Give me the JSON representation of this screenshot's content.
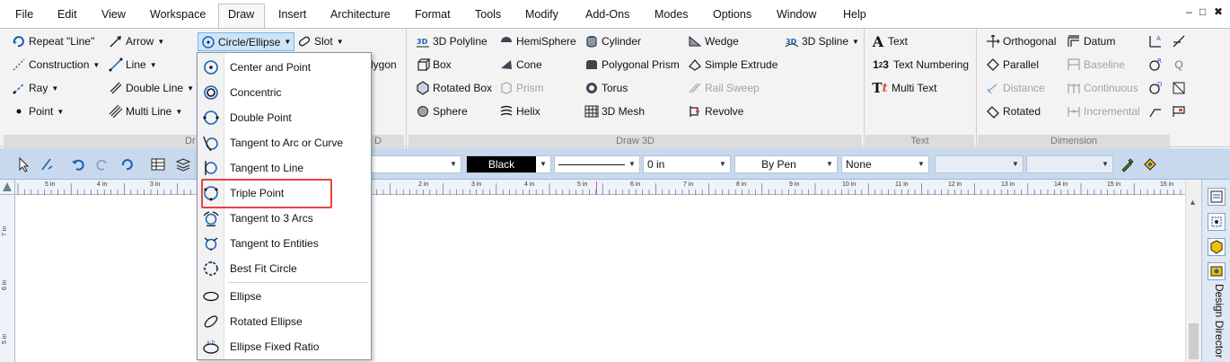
{
  "menubar": {
    "items": [
      "File",
      "Edit",
      "View",
      "Workspace",
      "Draw",
      "Insert",
      "Architecture",
      "Format",
      "Tools",
      "Modify",
      "Add-Ons",
      "Modes",
      "Options",
      "Window",
      "Help"
    ],
    "active": "Draw",
    "window_controls": [
      "–",
      "□",
      "✖"
    ]
  },
  "ribbon": {
    "draw2d": {
      "col1": [
        "Repeat \"Line\"",
        "Construction",
        "Ray",
        "Point"
      ],
      "col2": [
        "Arrow",
        "Line",
        "Double Line",
        "Multi Line"
      ],
      "circle_ellipse": "Circle/Ellipse",
      "slot": "Slot",
      "polygon_partial": "lygon",
      "group_partial_left": "Dr",
      "group_partial_right": "D"
    },
    "draw3d": {
      "col1": [
        "3D Polyline",
        "Box",
        "Rotated Box",
        "Sphere"
      ],
      "col2": [
        "HemiSphere",
        "Cone",
        "Prism",
        "Helix"
      ],
      "col3": [
        "Cylinder",
        "Polygonal Prism",
        "Torus",
        "3D Mesh"
      ],
      "col4": [
        "Wedge",
        "Simple Extrude",
        "Rail Sweep",
        "Revolve"
      ],
      "spline": "3D Spline",
      "label": "Draw 3D"
    },
    "text": {
      "items": [
        "Text",
        "Text Numbering",
        "Multi Text"
      ],
      "label": "Text"
    },
    "dimension": {
      "col1": [
        "Orthogonal",
        "Parallel",
        "Distance",
        "Rotated"
      ],
      "col2": [
        "Datum",
        "Baseline",
        "Continuous",
        "Incremental"
      ],
      "label": "Dimension"
    }
  },
  "toolbar": {
    "color": "Black",
    "thickness": "0 in",
    "pen": "By Pen",
    "fill": "None"
  },
  "ruler": {
    "labels": [
      "5 in",
      "4 in",
      "3 in",
      "2 in",
      "3 in",
      "4 in",
      "5 in",
      "6 in",
      "7 in",
      "8 in",
      "9 in",
      "10 in",
      "11 in",
      "12 in",
      "13 in",
      "14 in",
      "15 in",
      "16 in"
    ],
    "vertical": [
      "7 in",
      "6 in",
      "5 in"
    ]
  },
  "dropdown": {
    "items": [
      "Center and Point",
      "Concentric",
      "Double Point",
      "Tangent to Arc or Curve",
      "Tangent to Line",
      "Triple Point",
      "Tangent to 3 Arcs",
      "Tangent to Entities",
      "Best Fit Circle",
      "Ellipse",
      "Rotated Ellipse",
      "Ellipse Fixed Ratio"
    ],
    "highlighted": "Triple Point"
  },
  "side_panel": {
    "title": "Design Director"
  },
  "colors": {
    "accent_blue": "#1a5fb4",
    "highlight_red": "#e3473f",
    "toolbar_bg": "#c9d9ed",
    "ribbon_bg": "#f3f3f3"
  }
}
